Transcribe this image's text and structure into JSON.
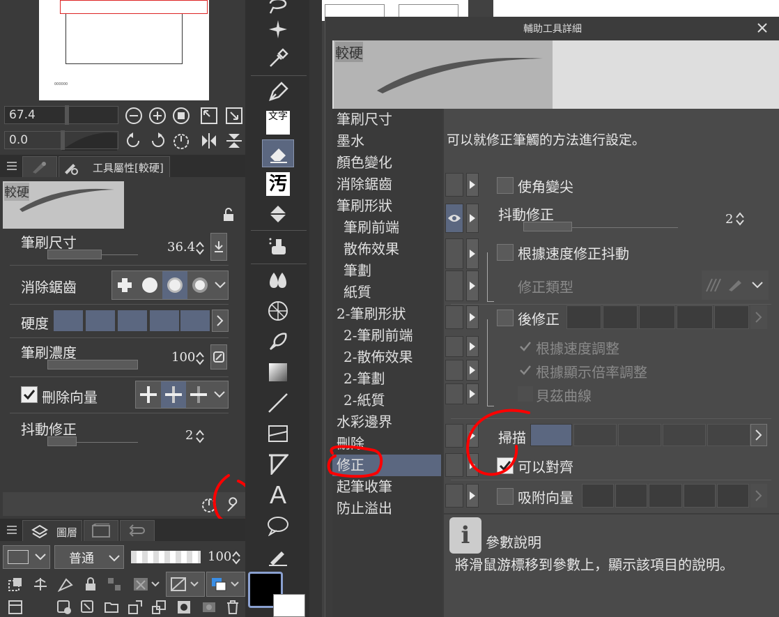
{
  "nav": {
    "zoom_value": "67.4",
    "rotate_value": "0.0",
    "canvas_mark": "000000"
  },
  "tool_property": {
    "tab_label": "工具屬性[較硬]",
    "brush_name": "較硬",
    "rows": {
      "brush_size": {
        "label": "筆刷尺寸",
        "value": "36.4"
      },
      "antialias": {
        "label": "消除鋸齒"
      },
      "hardness": {
        "label": "硬度"
      },
      "brush_density": {
        "label": "筆刷濃度",
        "value": "100"
      },
      "delete_vector": {
        "label": "刪除向量",
        "checked": true
      },
      "stabilization": {
        "label": "抖動修正",
        "value": "2"
      }
    }
  },
  "layer": {
    "tab_label": "圖層",
    "blend_mode": "普通",
    "opacity": "100"
  },
  "toolbar": {
    "text_tool_glyph": "A",
    "fill_glyph": "汚"
  },
  "dialog": {
    "title": "輔助工具詳細",
    "brush_name": "較硬",
    "description": "可以就修正筆觸的方法進行設定。",
    "categories": [
      "筆刷尺寸",
      "墨水",
      "顏色變化",
      "消除鋸齒",
      "筆刷形狀",
      "筆刷前端",
      "散佈效果",
      "筆劃",
      "紙質",
      "2-筆刷形狀",
      "2-筆刷前端",
      "2-散佈效果",
      "2-筆劃",
      "2-紙質",
      "水彩邊界",
      "刪除",
      "修正",
      "起筆收筆",
      "防止溢出"
    ],
    "settings": {
      "sharpen_corners": "使角變尖",
      "stabilization": {
        "label": "抖動修正",
        "value": "2"
      },
      "speed_stabilization": "根據速度修正抖動",
      "correction_type": "修正類型",
      "post_correction": "後修正",
      "adjust_by_speed": "根據速度調整",
      "adjust_by_zoom": "根據顯示倍率調整",
      "bezier": "貝茲曲線",
      "sweep": "掃描",
      "snap": "可以對齊",
      "snap_to_vector": "吸附向量"
    },
    "help": {
      "title": "參數說明",
      "text": "將滑鼠游標移到參數上，顯示該項目的說明。"
    }
  },
  "colors": {
    "accent": "#5b6780",
    "annotation": "#ff0000",
    "panel": "#3a3a3a"
  }
}
